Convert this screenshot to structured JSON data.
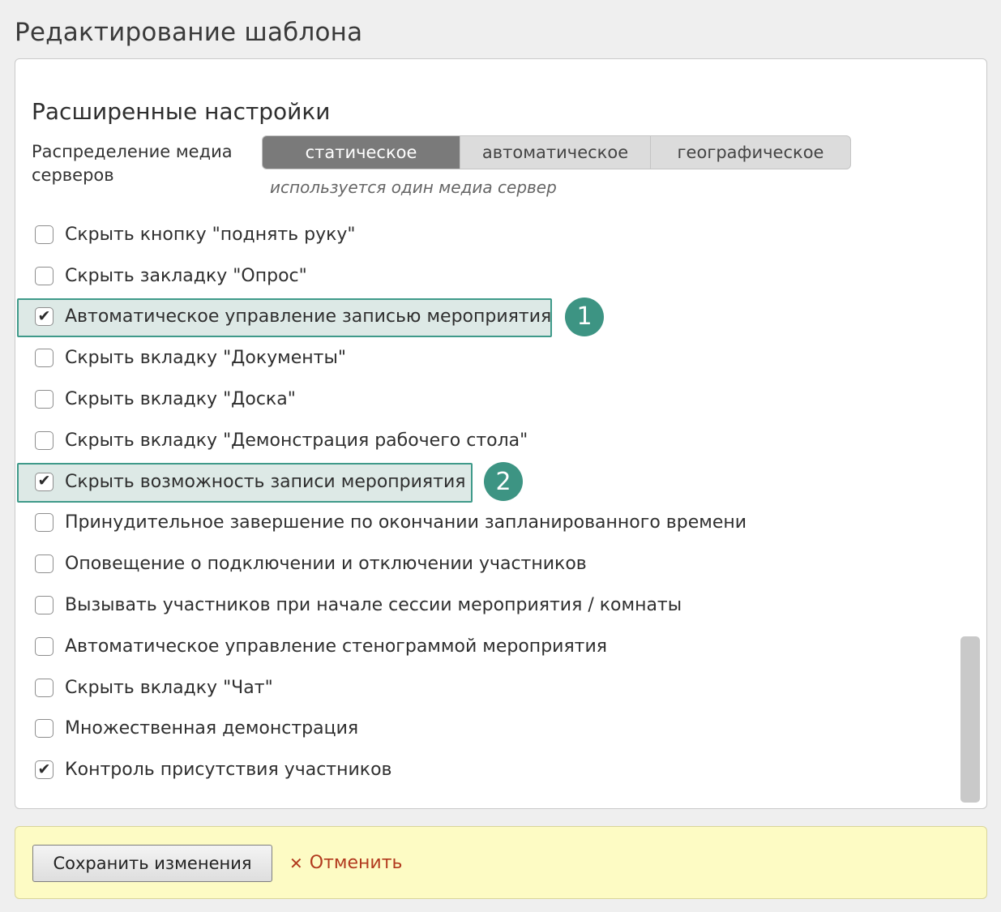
{
  "page": {
    "title": "Редактирование шаблона"
  },
  "advanced": {
    "title": "Расширенные настройки",
    "distribution_label": "Распределение медиа серверов",
    "modes": [
      {
        "label": "статическое",
        "active": true
      },
      {
        "label": "автоматическое",
        "active": false
      },
      {
        "label": "географическое",
        "active": false
      }
    ],
    "hint": "используется один медиа сервер"
  },
  "options": [
    {
      "label": "Скрыть кнопку \"поднять руку\"",
      "checked": false
    },
    {
      "label": "Скрыть закладку \"Опрос\"",
      "checked": false
    },
    {
      "label": "Автоматическое управление записью мероприятия",
      "checked": true,
      "callout": "1"
    },
    {
      "label": "Скрыть вкладку \"Документы\"",
      "checked": false
    },
    {
      "label": "Скрыть вкладку \"Доска\"",
      "checked": false
    },
    {
      "label": "Скрыть вкладку \"Демонстрация рабочего стола\"",
      "checked": false
    },
    {
      "label": "Скрыть возможность записи мероприятия",
      "checked": true,
      "callout": "2"
    },
    {
      "label": "Принудительное завершение по окончании запланированного времени",
      "checked": false
    },
    {
      "label": "Оповещение о подключении и отключении участников",
      "checked": false
    },
    {
      "label": "Вызывать участников при начале сессии мероприятия / комнаты",
      "checked": false
    },
    {
      "label": "Автоматическое управление стенограммой мероприятия",
      "checked": false
    },
    {
      "label": "Скрыть вкладку \"Чат\"",
      "checked": false
    },
    {
      "label": "Множественная демонстрация",
      "checked": false
    },
    {
      "label": "Контроль присутствия участников",
      "checked": true
    }
  ],
  "footer": {
    "save_label": "Сохранить изменения",
    "cancel_label": "Отменить"
  },
  "colors": {
    "accent": "#3d9483",
    "highlight_bg": "#dde9e6",
    "footer_bg": "#fdfbc4",
    "cancel": "#b23a1e",
    "active_segment": "#7a7a7a"
  },
  "icons": {
    "check": "checkmark-icon",
    "cancel": "close-icon"
  }
}
